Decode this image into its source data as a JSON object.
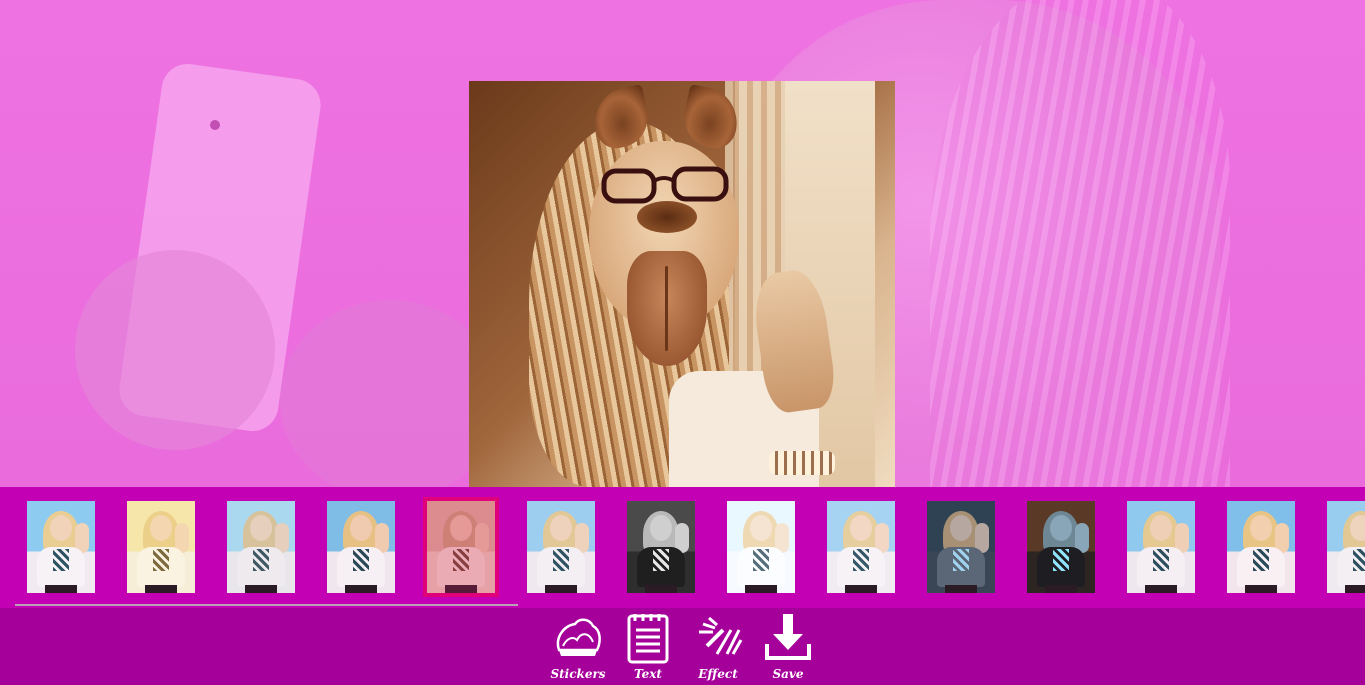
{
  "app": {
    "accent": "#c400b4",
    "toolbar_color": "#a6009a",
    "background_tint": "#ee6fe0",
    "selection_color": "#e0007a"
  },
  "filters": {
    "selected_index": 4,
    "items": [
      {
        "sky": "#8ecbf1",
        "ground": "#f2eaf1",
        "skin": "#f0d3b8",
        "hair": "#e9cd93",
        "top": "#f7f2f5",
        "pat": "#2d5462"
      },
      {
        "sky": "#f6e6a9",
        "ground": "#f7eed8",
        "skin": "#f4d7b0",
        "hair": "#ecd08a",
        "top": "#fbf3e2",
        "pat": "#7d6b3e"
      },
      {
        "sky": "#a9d8ef",
        "ground": "#e8e6ea",
        "skin": "#e6cfbd",
        "hair": "#d8c29b",
        "top": "#eeeaee",
        "pat": "#3f5a62"
      },
      {
        "sky": "#7fbde7",
        "ground": "#f0e6ee",
        "skin": "#f1cbb0",
        "hair": "#e7c184",
        "top": "#f6eff3",
        "pat": "#2a4a58"
      },
      {
        "sky": "#dcb198",
        "ground": "#e9cdb8",
        "skin": "#e8c3a6",
        "hair": "#caa17a",
        "top": "#efdacb",
        "pat": "#6d4a33"
      },
      {
        "sky": "#9dcdef",
        "ground": "#efe8ef",
        "skin": "#eed2bb",
        "hair": "#e2c897",
        "top": "#f4eff2",
        "pat": "#2f5463"
      },
      {
        "sky": "#4a4a4a",
        "ground": "#2e2e2e",
        "skin": "#cfcfcf",
        "hair": "#b9b9b9",
        "top": "#1f1f1f",
        "pat": "#e6e6e6"
      },
      {
        "sky": "#e9f8ff",
        "ground": "#f7fbff",
        "skin": "#f6e4d3",
        "hair": "#efd9b2",
        "top": "#fbfdff",
        "pat": "#55707a"
      },
      {
        "sky": "#a7d3f2",
        "ground": "#f1ebf2",
        "skin": "#f2d8c4",
        "hair": "#e6ce9e",
        "top": "#f6f2f6",
        "pat": "#35596a"
      },
      {
        "sky": "#2f4253",
        "ground": "#3a4656",
        "skin": "#b6a7a0",
        "hair": "#a89074",
        "top": "#5b6776",
        "pat": "#9fd2ee"
      },
      {
        "sky": "#5a3a26",
        "ground": "#2c2522",
        "skin": "#89a6b8",
        "hair": "#6e8794",
        "top": "#1d1d22",
        "pat": "#8fe3ff"
      },
      {
        "sky": "#8fc9ee",
        "ground": "#efe7ee",
        "skin": "#efd0b6",
        "hair": "#e5c990",
        "top": "#f5eff3",
        "pat": "#2c5060"
      },
      {
        "sky": "#7fbfe9",
        "ground": "#f2e6ec",
        "skin": "#f2cfae",
        "hair": "#e9c585",
        "top": "#f8f0f3",
        "pat": "#2a4c5a"
      },
      {
        "sky": "#98cdf0",
        "ground": "#efe9f0",
        "skin": "#eed3bd",
        "hair": "#e2c895",
        "top": "#f4eff3",
        "pat": "#2e5262"
      }
    ]
  },
  "toolbar": {
    "stickers": {
      "label": "Stickers",
      "icon": "stickers-icon"
    },
    "text": {
      "label": "Text",
      "icon": "notepad-icon"
    },
    "effect": {
      "label": "Effect",
      "icon": "magic-wand-icon"
    },
    "save": {
      "label": "Save",
      "icon": "download-icon"
    }
  }
}
